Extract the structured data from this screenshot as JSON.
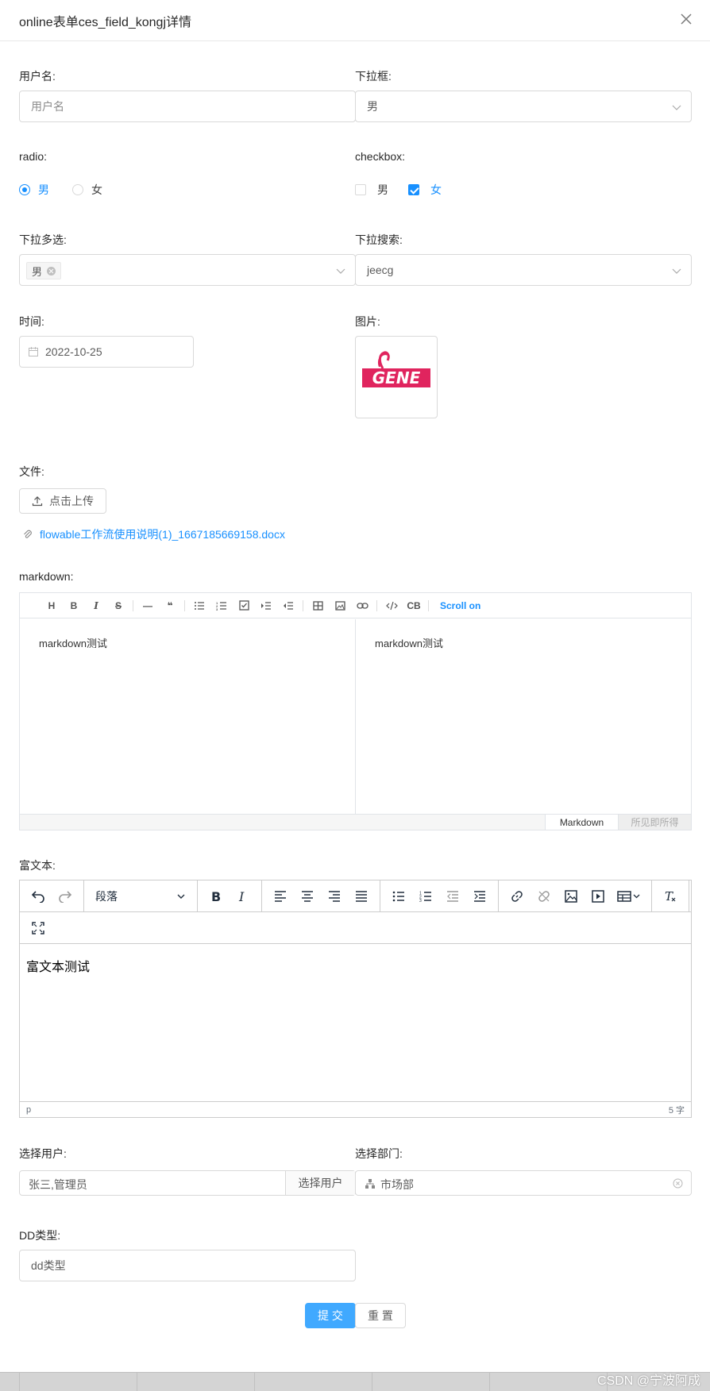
{
  "modal": {
    "title": "online表单ces_field_kongj详情"
  },
  "form": {
    "username": {
      "label": "用户名:",
      "placeholder": "用户名"
    },
    "dropdown": {
      "label": "下拉框:",
      "value": "男"
    },
    "radio": {
      "label": "radio:",
      "options": [
        "男",
        "女"
      ],
      "selected": "男"
    },
    "checkbox": {
      "label": "checkbox:",
      "options": [
        "男",
        "女"
      ],
      "checked": [
        "女"
      ]
    },
    "multi_select": {
      "label": "下拉多选:",
      "tags": [
        "男"
      ]
    },
    "search_select": {
      "label": "下拉搜索:",
      "value": "jeecg"
    },
    "time": {
      "label": "时间:",
      "value": "2022-10-25"
    },
    "image": {
      "label": "图片:",
      "logo_text": "GENE"
    },
    "file": {
      "label": "文件:",
      "upload_label": "点击上传",
      "file_name": "flowable工作流使用说明(1)_1667185669158.docx"
    },
    "markdown": {
      "label": "markdown:",
      "toolbar": [
        "H",
        "B",
        "I",
        "S",
        "—",
        "❝",
        "ul",
        "ol",
        "task",
        "indent",
        "outdent",
        "table",
        "image",
        "link",
        "code",
        "CB"
      ],
      "scroll_label": "Scroll on",
      "editor_text": "markdown测试",
      "preview_text": "markdown测试",
      "tab_markdown": "Markdown",
      "tab_wysiwyg": "所见即所得"
    },
    "rich_text": {
      "label": "富文本:",
      "block_format": "段落",
      "content": "富文本测试",
      "status_path": "p",
      "word_count": "5 字"
    },
    "select_user": {
      "label": "选择用户:",
      "value": "张三,管理员",
      "button": "选择用户"
    },
    "select_dept": {
      "label": "选择部门:",
      "value": "市场部"
    },
    "dd_type": {
      "label": "DD类型:",
      "value": "dd类型"
    }
  },
  "actions": {
    "submit": "提 交",
    "reset": "重 置"
  },
  "watermark": "CSDN @宁波阿成",
  "colors": {
    "primary": "#1890ff",
    "primary_button": "#40a9ff",
    "logo_red": "#e0245e"
  }
}
